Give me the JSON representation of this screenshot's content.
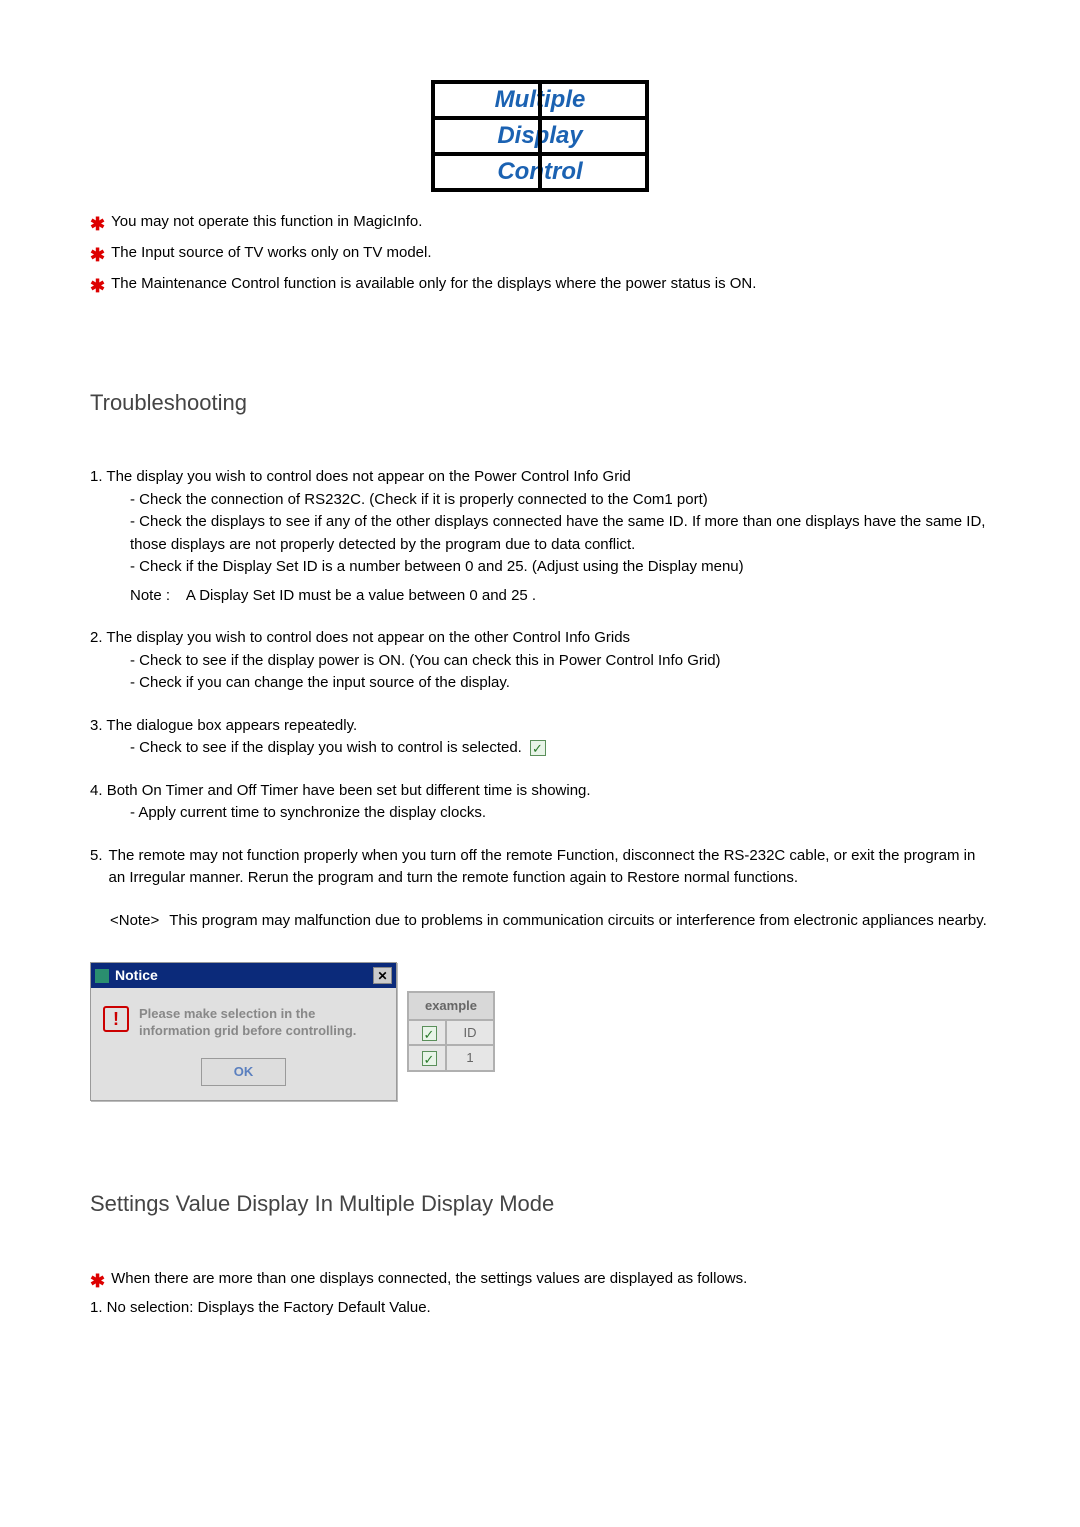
{
  "logo": {
    "line1": "Multiple",
    "line2": "Display",
    "line3": "Control"
  },
  "top_bullets": [
    "You may not operate this function in MagicInfo.",
    "The Input source of TV works only on TV model.",
    "The Maintenance Control function is available only for the displays where the power status is ON."
  ],
  "troubleshooting": {
    "heading": "Troubleshooting",
    "items": [
      {
        "num": "1.",
        "title": "The display you wish to control does not appear on the Power Control Info Grid",
        "subs": [
          "- Check the connection of RS232C. (Check if it is properly connected to the Com1 port)",
          "- Check the displays to see if any of the other displays connected have the same ID. If more than one displays have the same ID, those displays are not properly detected by the program due to data conflict.",
          "- Check if the Display Set ID is a number between 0 and 25. (Adjust using the Display menu)"
        ],
        "note_label": "Note :",
        "note_text": "A Display Set ID must be a value between 0 and 25 ."
      },
      {
        "num": "2.",
        "title": "The display you wish to control does not appear on the other Control Info Grids",
        "subs": [
          "- Check to see if the display power is ON. (You can check this in Power Control Info Grid)",
          "- Check if you can change the input source of the display."
        ]
      },
      {
        "num": "3.",
        "title": "The dialogue box appears repeatedly.",
        "subs": [
          "- Check to see if the display you wish to control is selected."
        ],
        "show_checkbox": true
      },
      {
        "num": "4.",
        "title": "Both On Timer and Off Timer have been set but different time is showing.",
        "subs": [
          "- Apply current time to synchronize the display clocks."
        ]
      },
      {
        "num": "5.",
        "title": "The remote may not function properly when you turn off the remote Function, disconnect the RS-232C cable, or exit the program in an Irregular manner. Rerun the program and turn the remote function again to Restore normal functions.",
        "subs": []
      }
    ],
    "final_note_label": "<Note>",
    "final_note_text": "This program may malfunction due to problems in communication circuits or interference from electronic appliances nearby."
  },
  "dialog": {
    "title": "Notice",
    "message": "Please make selection in the information grid before controlling.",
    "ok": "OK"
  },
  "example_grid": {
    "header": "example",
    "col2": "ID",
    "val": "1"
  },
  "settings": {
    "heading": "Settings Value Display In Multiple Display Mode",
    "star_line": "When there are more than one displays connected, the settings values are displayed as follows.",
    "line1": "1.  No selection: Displays the Factory Default Value."
  }
}
